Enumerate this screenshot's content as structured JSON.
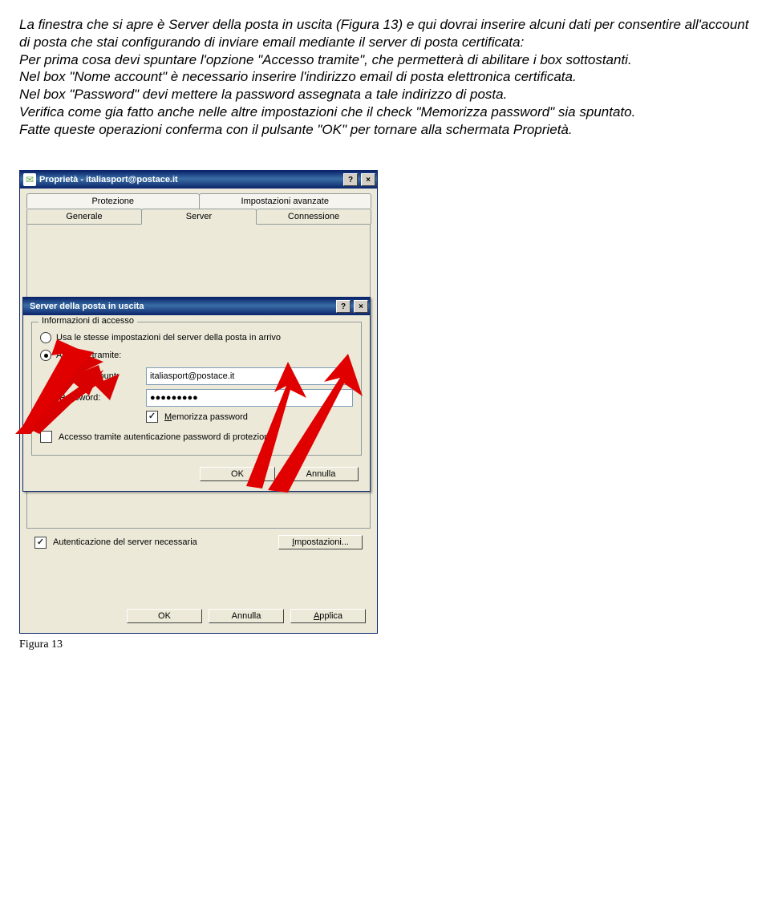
{
  "instructions": {
    "p1a": "La finestra che si apre è ",
    "p1b": "Server della posta in uscita",
    "p1c": " (Figura 13) e qui dovrai inserire alcuni dati per consentire all'account di posta che stai configurando di inviare email mediante il server di posta certificata:",
    "p2": "Per prima cosa devi spuntare l'opzione \"Accesso tramite\", che permetterà di abilitare i box sottostanti.",
    "p3": "Nel box \"Nome account\" è necessario inserire l'indirizzo email di posta elettronica certificata.",
    "p4": "Nel box \"Password\" devi mettere la password assegnata a tale indirizzo di posta.",
    "p5": "Verifica come gia fatto anche nelle altre impostazioni che il check \"Memorizza password\" sia spuntato.",
    "p6a": "Fatte queste operazioni conferma con il pulsante \"OK\" per tornare alla schermata ",
    "p6b": "Proprietà",
    "p6c": "."
  },
  "outerWindow": {
    "title": "Proprietà - italiasport@postace.it",
    "tabs_row1": [
      "Protezione",
      "Impostazioni avanzate"
    ],
    "tabs_row2": [
      "Generale",
      "Server",
      "Connessione"
    ],
    "auth_check_label": "Autenticazione del server necessaria",
    "impostazioni_btn": "Impostazioni...",
    "ok": "OK",
    "annulla": "Annulla",
    "applica": "Applica"
  },
  "innerWindow": {
    "title": "Server della posta in uscita",
    "group_label": "Informazioni di accesso",
    "radio1": "Usa le stesse impostazioni del server della posta in arrivo",
    "radio2": "Accesso tramite:",
    "nome_label": "Nome account:",
    "nome_value": "italiasport@postace.it",
    "pwd_label": "Password:",
    "pwd_value": "●●●●●●●●●",
    "memorizza": "Memorizza password",
    "secure_auth": "Accesso tramite autenticazione password di protezione",
    "ok": "OK",
    "annulla": "Annulla"
  },
  "caption": "Figura 13"
}
